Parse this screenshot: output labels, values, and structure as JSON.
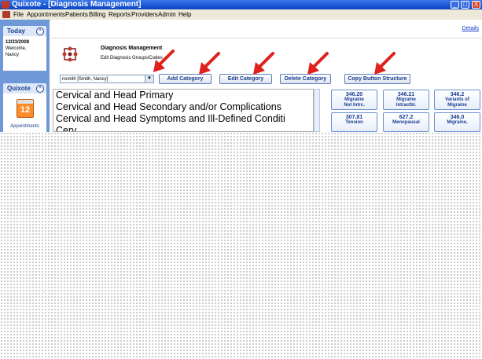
{
  "window": {
    "title": "Quixote - [Diagnosis Management]",
    "buttons": [
      "_",
      "□",
      "X"
    ]
  },
  "menu": {
    "items": [
      "File",
      "Appointments",
      "Patients",
      "Billing",
      "Reports",
      "Providers",
      "Admin",
      "Help"
    ]
  },
  "sidebar": {
    "today": {
      "header": "Today",
      "date": "12/23/2008",
      "welcome": "Welcome,",
      "user": "Nancy"
    },
    "quixote": {
      "header": "Quixote",
      "calendar_day": "12",
      "appointments_label": "Appointments"
    }
  },
  "main": {
    "details_link": "Details",
    "title": "Diagnosis Management",
    "subtitle": "Edit Diagnosis Groups/Codes",
    "user_select": "nsmith [Smith, Nancy]",
    "buttons": {
      "add": "Add Category",
      "edit": "Edit Category",
      "delete": "Delete Category",
      "copy": "Copy Button Structure"
    },
    "categories": [
      "Cervical and Head Primary",
      "Cervical and Head Secondary and/or Complications",
      "Cervical and Head Symptoms and Ill-Defined Conditi",
      "Cerv"
    ],
    "codes": [
      {
        "code": "346.20",
        "line1": "Migraine",
        "line2": "Not Intrc."
      },
      {
        "code": "346.21",
        "line1": "Migraine",
        "line2": "Intractbl."
      },
      {
        "code": "346.2",
        "line1": "Variants of",
        "line2": "Migraine"
      },
      {
        "code": "307.81",
        "line1": "Tension",
        "line2": ""
      },
      {
        "code": "627.2",
        "line1": "Menopausal",
        "line2": ""
      },
      {
        "code": "346.0",
        "line1": "Migraine,",
        "line2": ""
      }
    ]
  },
  "colors": {
    "titlebar": "#1957d6",
    "sidebar": "#6f98d8",
    "accent_text": "#1a3d8f",
    "arrows": "#e0201c"
  }
}
